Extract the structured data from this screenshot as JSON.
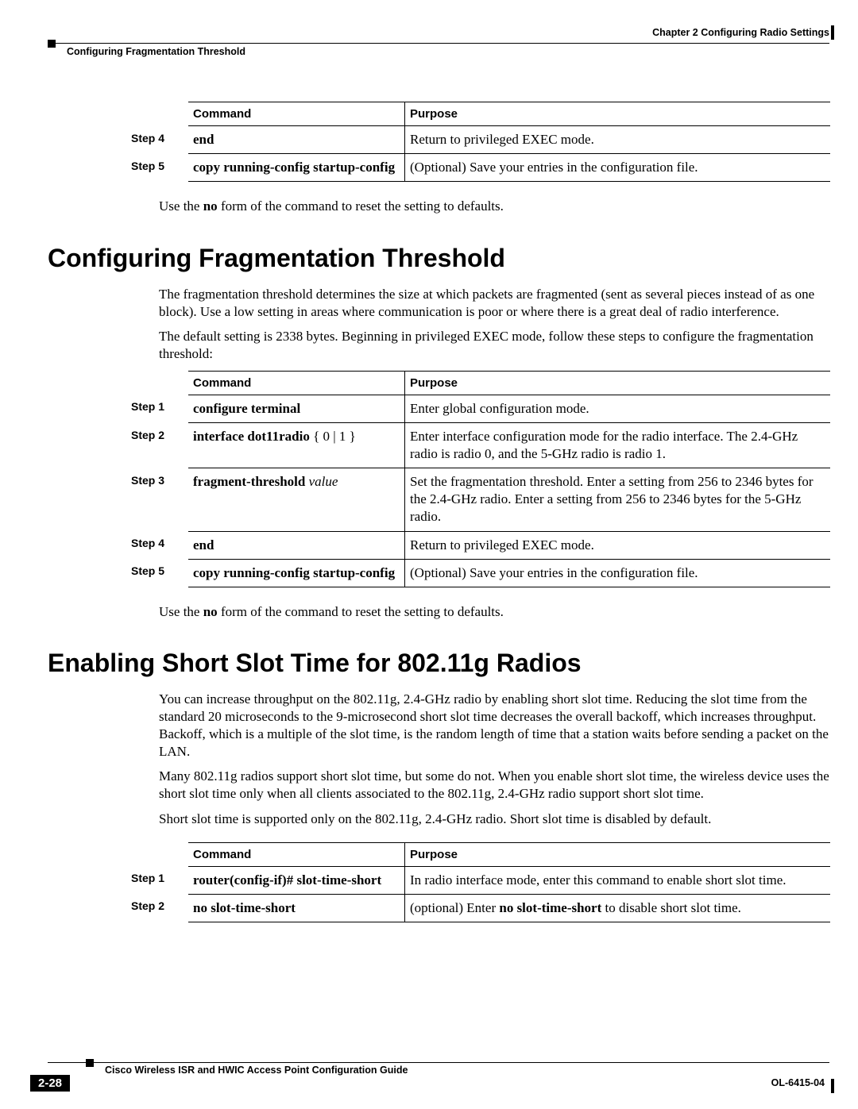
{
  "header": {
    "chapter": "Chapter 2      Configuring Radio Settings",
    "section": "Configuring Fragmentation Threshold"
  },
  "table1": {
    "head_cmd": "Command",
    "head_purp": "Purpose",
    "rows": [
      {
        "step": "Step 4",
        "cmd_b": "end",
        "purp": "Return to privileged EXEC mode."
      },
      {
        "step": "Step 5",
        "cmd_b": "copy running-config startup-config",
        "purp": "(Optional) Save your entries in the configuration file."
      }
    ]
  },
  "note1_a": "Use the ",
  "note1_b": "no",
  "note1_c": " form of the command to reset the setting to defaults.",
  "h1a": "Configuring Fragmentation Threshold",
  "p1a": "The fragmentation threshold determines the size at which packets are fragmented (sent as several pieces instead of as one block). Use a low setting in areas where communication is poor or where there is a great deal of radio interference.",
  "p1b": "The default setting is 2338 bytes. Beginning in privileged EXEC mode, follow these steps to configure the fragmentation threshold:",
  "table2": {
    "head_cmd": "Command",
    "head_purp": "Purpose",
    "r1": {
      "step": "Step 1",
      "cmd_b": "configure terminal",
      "purp": "Enter global configuration mode."
    },
    "r2": {
      "step": "Step 2",
      "cmd_pre": "interface dot11radio",
      "cmd_arg": " { 0 | 1 }",
      "purp": "Enter interface configuration mode for the radio interface. The 2.4-GHz radio is radio 0, and the 5-GHz radio is radio 1."
    },
    "r3": {
      "step": "Step 3",
      "cmd_b": "fragment-threshold",
      "cmd_i": " value",
      "purp": "Set the fragmentation threshold. Enter a setting from 256 to 2346 bytes for the 2.4-GHz radio. Enter a setting from 256 to 2346 bytes for the 5-GHz radio."
    },
    "r4": {
      "step": "Step 4",
      "cmd_b": "end",
      "purp": "Return to privileged EXEC mode."
    },
    "r5": {
      "step": "Step 5",
      "cmd_b": "copy running-config startup-config",
      "purp": "(Optional) Save your entries in the configuration file."
    }
  },
  "note2_a": "Use the ",
  "note2_b": "no",
  "note2_c": " form of the command to reset the setting to defaults.",
  "h1b": "Enabling Short Slot Time for 802.11g Radios",
  "p2a": "You can increase throughput on the 802.11g, 2.4-GHz radio by enabling short slot time. Reducing the slot time from the standard 20 microseconds to the 9-microsecond short slot time decreases the overall backoff, which increases throughput. Backoff, which is a multiple of the slot time, is the random length of time that a station waits before sending a packet on the LAN.",
  "p2b": "Many 802.11g radios support short slot time, but some do not. When you enable short slot time, the wireless device uses the short slot time only when all clients associated to the 802.11g, 2.4-GHz radio support short slot time.",
  "p2c": "Short slot time is supported only on the 802.11g, 2.4-GHz radio. Short slot time is disabled by default.",
  "table3": {
    "head_cmd": "Command",
    "head_purp": "Purpose",
    "r1": {
      "step": "Step 1",
      "cmd_b": "router(config-if)# slot-time-short",
      "purp": "In radio interface mode, enter this command to enable short slot time."
    },
    "r2": {
      "step": "Step 2",
      "cmd_b": "no slot-time-short",
      "purp_a": "(optional) Enter ",
      "purp_b": "no slot-time-short",
      "purp_c": " to disable short slot time."
    }
  },
  "footer": {
    "title": "Cisco Wireless ISR and HWIC Access Point Configuration Guide",
    "doc": "OL-6415-04",
    "pagenum": "2-28"
  }
}
